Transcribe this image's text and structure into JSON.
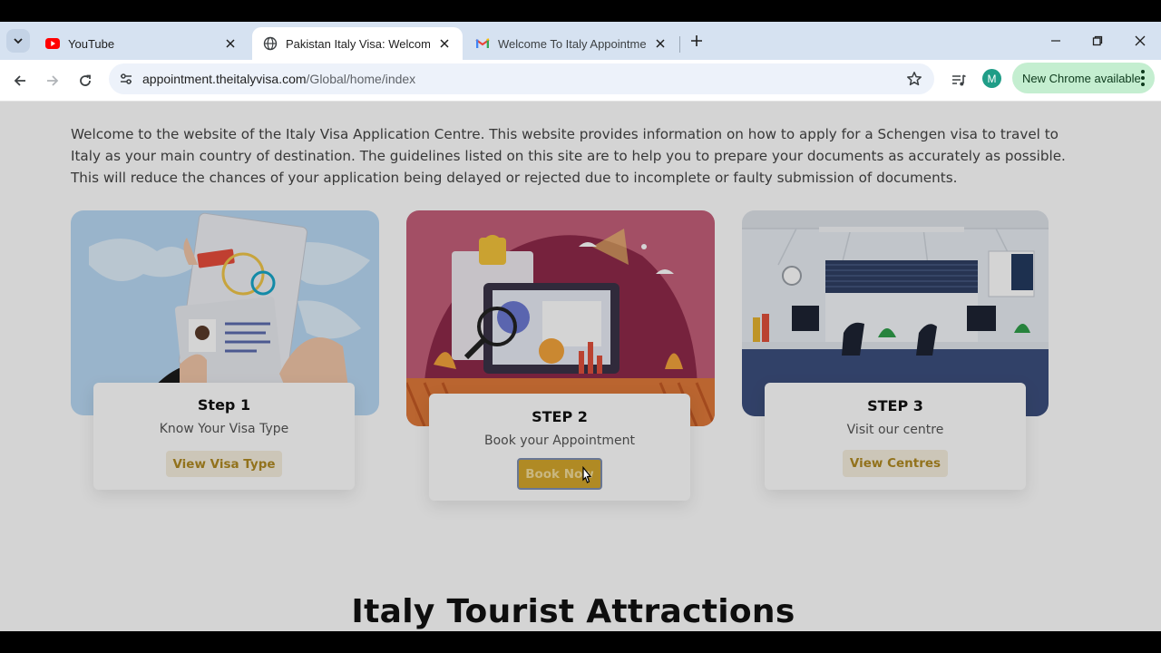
{
  "browser": {
    "tabs": [
      {
        "title": "YouTube",
        "favicon": "youtube-icon",
        "active": false
      },
      {
        "title": "Pakistan Italy Visa: Welcome to",
        "favicon": "globe-icon",
        "active": true
      },
      {
        "title": "Welcome To Italy Appointment",
        "favicon": "gmail-icon",
        "active": false
      }
    ],
    "url_host": "appointment.theitalyvisa.com",
    "url_path": "/Global/home/index",
    "avatar_letter": "M",
    "update_label": "New Chrome available"
  },
  "page": {
    "intro": "Welcome to the website of the Italy Visa Application Centre. This website provides information on how to apply for a Schengen visa to travel to Italy as your main country of destination. The guidelines listed on this site are to help you to prepare your documents as accurately as possible. This will reduce the chances of your application being delayed or rejected due to incomplete or faulty submission of documents.",
    "steps": [
      {
        "title": "Step 1",
        "subtitle": "Know Your Visa Type",
        "button": "View Visa Type"
      },
      {
        "title": "STEP 2",
        "subtitle": "Book your Appointment",
        "button": "Book Now"
      },
      {
        "title": "STEP 3",
        "subtitle": "Visit our centre",
        "button": "View Centres"
      }
    ],
    "section_heading": "Italy Tourist Attractions"
  },
  "colors": {
    "accent_gold": "#d4a72c",
    "button_text_gold": "#b08a22",
    "chrome_tab_strip": "#d6e2f1",
    "update_chip": "#c4eed0"
  }
}
